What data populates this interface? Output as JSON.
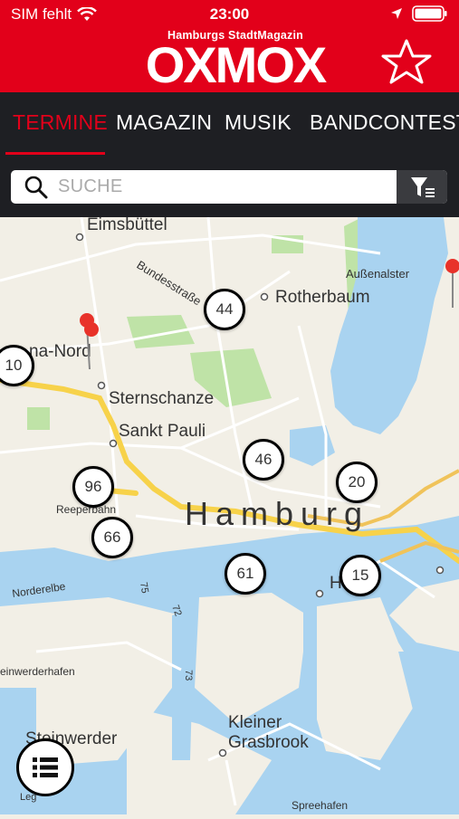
{
  "status_bar": {
    "carrier": "SIM fehlt",
    "time": "23:00",
    "icons": [
      "wifi-icon",
      "location-arrow-icon",
      "battery-icon"
    ]
  },
  "header": {
    "logo_subtitle": "Hamburgs StadtMagazin",
    "logo_title": "OXMOX",
    "favorite_icon": "star-icon",
    "brand_color": "#e2001a"
  },
  "tabs": [
    {
      "label": "TERMINE",
      "active": true
    },
    {
      "label": "MAGAZIN",
      "active": false
    },
    {
      "label": "MUSIK",
      "active": false
    },
    {
      "label": "BANDCONTEST",
      "active": false
    }
  ],
  "search": {
    "placeholder": "SUCHE",
    "search_icon": "magnifier-icon",
    "filter_icon": "filter-icon"
  },
  "map": {
    "labels": {
      "eimsbuttel": "Eimsbüttel",
      "rotherbaum": "Rotherbaum",
      "bundesstrasse": "Bundesstraße",
      "altona_nord": "na-Nord",
      "sternschanze": "Sternschanze",
      "sankt_pauli": "Sankt Pauli",
      "hamburg": "Hamburg",
      "aussenalster": "Außenalster",
      "reeperbahn": "Reeperbahn",
      "norderelbe": "Norderelbe",
      "hafencity": "H     city",
      "steinwerder": "Steinwerder",
      "kleiner": "Kleiner",
      "grasbrook": "Grasbrook",
      "steinwerderhafen": "einwerderhafen",
      "spreehafen": "Spreehafen",
      "road_72": "72",
      "road_73": "73",
      "road_75": "75",
      "legal": "Leg"
    },
    "clusters": [
      {
        "count": "44"
      },
      {
        "count": "10"
      },
      {
        "count": "46"
      },
      {
        "count": "20"
      },
      {
        "count": "96"
      },
      {
        "count": "66"
      },
      {
        "count": "61"
      },
      {
        "count": "15"
      }
    ],
    "list_button_icon": "list-icon"
  }
}
